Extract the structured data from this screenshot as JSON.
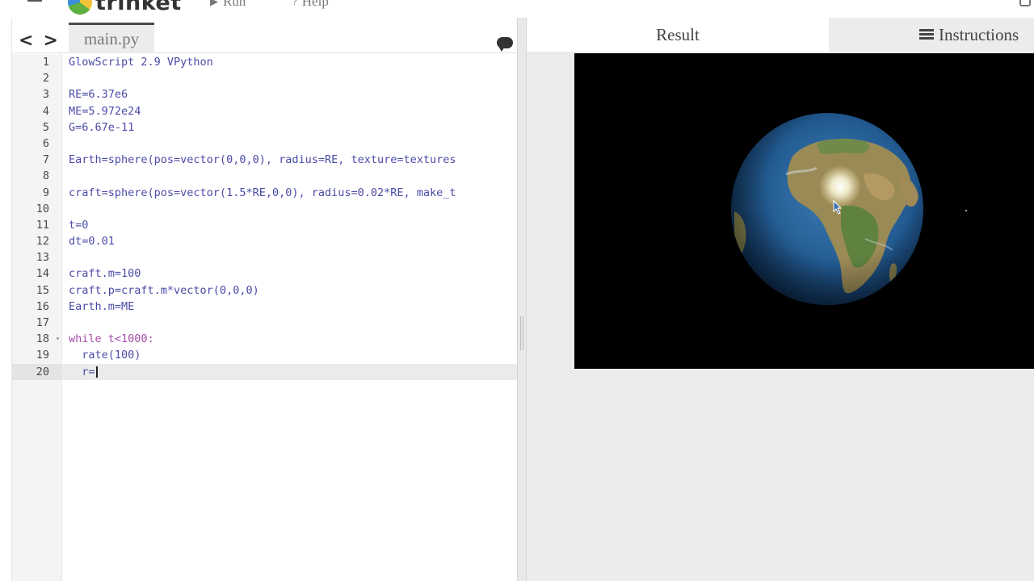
{
  "topbar": {
    "menu_icon": "hamburger-icon",
    "logo_text": "trinket",
    "run_label": "Run",
    "run_icon": "play-icon",
    "help_label": "Help",
    "help_icon": "question-icon"
  },
  "editor": {
    "nav_back": "<",
    "nav_forward": ">",
    "file_tab": "main.py",
    "chat_icon": "chat-bubble-icon",
    "active_line": 20,
    "lines": [
      {
        "num": "1",
        "text": "GlowScript 2.9 VPython"
      },
      {
        "num": "2",
        "text": ""
      },
      {
        "num": "3",
        "text": "RE=6.37e6"
      },
      {
        "num": "4",
        "text": "ME=5.972e24"
      },
      {
        "num": "5",
        "text": "G=6.67e-11"
      },
      {
        "num": "6",
        "text": ""
      },
      {
        "num": "7",
        "text": "Earth=sphere(pos=vector(0,0,0), radius=RE, texture=textures"
      },
      {
        "num": "8",
        "text": ""
      },
      {
        "num": "9",
        "text": "craft=sphere(pos=vector(1.5*RE,0,0), radius=0.02*RE, make_t"
      },
      {
        "num": "10",
        "text": ""
      },
      {
        "num": "11",
        "text": "t=0"
      },
      {
        "num": "12",
        "text": "dt=0.01"
      },
      {
        "num": "13",
        "text": ""
      },
      {
        "num": "14",
        "text": "craft.m=100"
      },
      {
        "num": "15",
        "text": "craft.p=craft.m*vector(0,0,0)"
      },
      {
        "num": "16",
        "text": "Earth.m=ME"
      },
      {
        "num": "17",
        "text": ""
      },
      {
        "num": "18",
        "text": "while t<1000:"
      },
      {
        "num": "19",
        "text": "  rate(100)"
      },
      {
        "num": "20",
        "text": "  r="
      }
    ]
  },
  "output": {
    "tab_result": "Result",
    "tab_instructions": "Instructions",
    "instructions_icon": "list-icon",
    "scene": "earth-sphere-render"
  },
  "colors": {
    "code_default": "#4b4ba8",
    "code_keyword": "#a64ba8",
    "canvas_bg": "#000000",
    "pane_bg": "#ececec"
  }
}
